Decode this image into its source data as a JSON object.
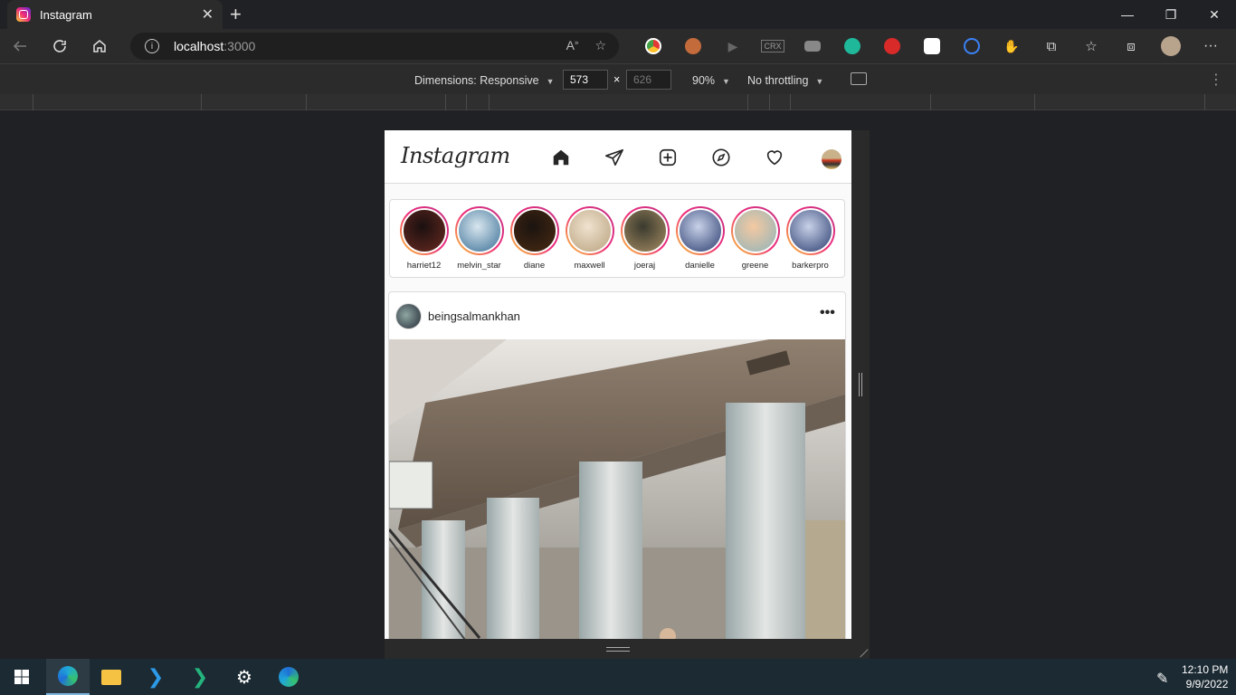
{
  "browser": {
    "tab_title": "Instagram",
    "tab_close": "✕",
    "new_tab": "+",
    "window_controls": [
      "—",
      "❐",
      "✕"
    ],
    "url_host": "localhost",
    "url_port": ":3000"
  },
  "devtools": {
    "dimensions_label": "Dimensions: Responsive",
    "width": "573",
    "height": "626",
    "times": "×",
    "zoom": "90%",
    "throttling": "No throttling",
    "more": "⋮"
  },
  "instagram": {
    "logo": "Instagram",
    "stories": [
      {
        "name": "harriet12",
        "colors": [
          "#1a1010",
          "#6b2a20"
        ]
      },
      {
        "name": "melvin_star",
        "colors": [
          "#d8e6ee",
          "#3a6f96"
        ]
      },
      {
        "name": "diane",
        "colors": [
          "#1b1410",
          "#4a2a12"
        ]
      },
      {
        "name": "maxwell",
        "colors": [
          "#efe2cf",
          "#b9a27e"
        ]
      },
      {
        "name": "joeraj",
        "colors": [
          "#3a3a2e",
          "#a78d63"
        ]
      },
      {
        "name": "danielle",
        "colors": [
          "#c8d1e8",
          "#2b3d70"
        ]
      },
      {
        "name": "greene",
        "colors": [
          "#f4c9a2",
          "#8fb3b9"
        ]
      },
      {
        "name": "barkerpro",
        "colors": [
          "#c8d1e8",
          "#2b3d70"
        ]
      }
    ],
    "post": {
      "username": "beingsalmankhan",
      "more": "•••"
    }
  },
  "taskbar": {
    "time": "12:10 PM",
    "date": "9/9/2022"
  }
}
